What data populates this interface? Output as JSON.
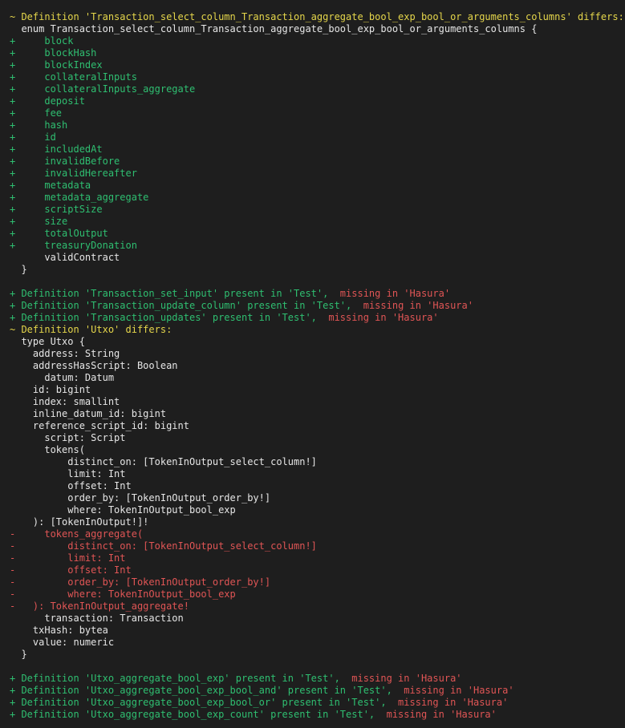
{
  "colors": {
    "background": "#1e1e1e",
    "normal": "#e6e6e6",
    "yellow": "#e5d64b",
    "green": "#2fbf71",
    "red": "#e05555"
  },
  "lines": [
    {
      "segments": [
        {
          "text": "~ Definition 'Transaction_select_column_Transaction_aggregate_bool_exp_bool_or_arguments_columns' differs:",
          "color": "yellow"
        }
      ]
    },
    {
      "segments": [
        {
          "text": "  enum Transaction_select_column_Transaction_aggregate_bool_exp_bool_or_arguments_columns {",
          "color": "normal"
        }
      ]
    },
    {
      "segments": [
        {
          "text": "+     block",
          "color": "green"
        }
      ]
    },
    {
      "segments": [
        {
          "text": "+     blockHash",
          "color": "green"
        }
      ]
    },
    {
      "segments": [
        {
          "text": "+     blockIndex",
          "color": "green"
        }
      ]
    },
    {
      "segments": [
        {
          "text": "+     collateralInputs",
          "color": "green"
        }
      ]
    },
    {
      "segments": [
        {
          "text": "+     collateralInputs_aggregate",
          "color": "green"
        }
      ]
    },
    {
      "segments": [
        {
          "text": "+     deposit",
          "color": "green"
        }
      ]
    },
    {
      "segments": [
        {
          "text": "+     fee",
          "color": "green"
        }
      ]
    },
    {
      "segments": [
        {
          "text": "+     hash",
          "color": "green"
        }
      ]
    },
    {
      "segments": [
        {
          "text": "+     id",
          "color": "green"
        }
      ]
    },
    {
      "segments": [
        {
          "text": "+     includedAt",
          "color": "green"
        }
      ]
    },
    {
      "segments": [
        {
          "text": "+     invalidBefore",
          "color": "green"
        }
      ]
    },
    {
      "segments": [
        {
          "text": "+     invalidHereafter",
          "color": "green"
        }
      ]
    },
    {
      "segments": [
        {
          "text": "+     metadata",
          "color": "green"
        }
      ]
    },
    {
      "segments": [
        {
          "text": "+     metadata_aggregate",
          "color": "green"
        }
      ]
    },
    {
      "segments": [
        {
          "text": "+     scriptSize",
          "color": "green"
        }
      ]
    },
    {
      "segments": [
        {
          "text": "+     size",
          "color": "green"
        }
      ]
    },
    {
      "segments": [
        {
          "text": "+     totalOutput",
          "color": "green"
        }
      ]
    },
    {
      "segments": [
        {
          "text": "+     treasuryDonation",
          "color": "green"
        }
      ]
    },
    {
      "segments": [
        {
          "text": "      validContract",
          "color": "normal"
        }
      ]
    },
    {
      "segments": [
        {
          "text": "  }",
          "color": "normal"
        }
      ]
    },
    {
      "segments": [
        {
          "text": "",
          "color": "normal"
        }
      ]
    },
    {
      "segments": [
        {
          "text": "+ Definition 'Transaction_set_input' present in 'Test',",
          "color": "green"
        },
        {
          "text": "  missing in 'Hasura'",
          "color": "red"
        }
      ]
    },
    {
      "segments": [
        {
          "text": "+ Definition 'Transaction_update_column' present in 'Test',",
          "color": "green"
        },
        {
          "text": "  missing in 'Hasura'",
          "color": "red"
        }
      ]
    },
    {
      "segments": [
        {
          "text": "+ Definition 'Transaction_updates' present in 'Test',",
          "color": "green"
        },
        {
          "text": "  missing in 'Hasura'",
          "color": "red"
        }
      ]
    },
    {
      "segments": [
        {
          "text": "~ Definition 'Utxo' differs:",
          "color": "yellow"
        }
      ]
    },
    {
      "segments": [
        {
          "text": "  type Utxo {",
          "color": "normal"
        }
      ]
    },
    {
      "segments": [
        {
          "text": "    address: String",
          "color": "normal"
        }
      ]
    },
    {
      "segments": [
        {
          "text": "    addressHasScript: Boolean",
          "color": "normal"
        }
      ]
    },
    {
      "segments": [
        {
          "text": "      datum: Datum",
          "color": "normal"
        }
      ]
    },
    {
      "segments": [
        {
          "text": "    id: bigint",
          "color": "normal"
        }
      ]
    },
    {
      "segments": [
        {
          "text": "    index: smallint",
          "color": "normal"
        }
      ]
    },
    {
      "segments": [
        {
          "text": "    inline_datum_id: bigint",
          "color": "normal"
        }
      ]
    },
    {
      "segments": [
        {
          "text": "    reference_script_id: bigint",
          "color": "normal"
        }
      ]
    },
    {
      "segments": [
        {
          "text": "      script: Script",
          "color": "normal"
        }
      ]
    },
    {
      "segments": [
        {
          "text": "      tokens(",
          "color": "normal"
        }
      ]
    },
    {
      "segments": [
        {
          "text": "          distinct_on: [TokenInOutput_select_column!]",
          "color": "normal"
        }
      ]
    },
    {
      "segments": [
        {
          "text": "          limit: Int",
          "color": "normal"
        }
      ]
    },
    {
      "segments": [
        {
          "text": "          offset: Int",
          "color": "normal"
        }
      ]
    },
    {
      "segments": [
        {
          "text": "          order_by: [TokenInOutput_order_by!]",
          "color": "normal"
        }
      ]
    },
    {
      "segments": [
        {
          "text": "          where: TokenInOutput_bool_exp",
          "color": "normal"
        }
      ]
    },
    {
      "segments": [
        {
          "text": "    ): [TokenInOutput!]!",
          "color": "normal"
        }
      ]
    },
    {
      "segments": [
        {
          "text": "-     tokens_aggregate(",
          "color": "red"
        }
      ]
    },
    {
      "segments": [
        {
          "text": "-         distinct_on: [TokenInOutput_select_column!]",
          "color": "red"
        }
      ]
    },
    {
      "segments": [
        {
          "text": "-         limit: Int",
          "color": "red"
        }
      ]
    },
    {
      "segments": [
        {
          "text": "-         offset: Int",
          "color": "red"
        }
      ]
    },
    {
      "segments": [
        {
          "text": "-         order_by: [TokenInOutput_order_by!]",
          "color": "red"
        }
      ]
    },
    {
      "segments": [
        {
          "text": "-         where: TokenInOutput_bool_exp",
          "color": "red"
        }
      ]
    },
    {
      "segments": [
        {
          "text": "-   ): TokenInOutput_aggregate!",
          "color": "red"
        }
      ]
    },
    {
      "segments": [
        {
          "text": "      transaction: Transaction",
          "color": "normal"
        }
      ]
    },
    {
      "segments": [
        {
          "text": "    txHash: bytea",
          "color": "normal"
        }
      ]
    },
    {
      "segments": [
        {
          "text": "    value: numeric",
          "color": "normal"
        }
      ]
    },
    {
      "segments": [
        {
          "text": "  }",
          "color": "normal"
        }
      ]
    },
    {
      "segments": [
        {
          "text": "",
          "color": "normal"
        }
      ]
    },
    {
      "segments": [
        {
          "text": "+ Definition 'Utxo_aggregate_bool_exp' present in 'Test',",
          "color": "green"
        },
        {
          "text": "  missing in 'Hasura'",
          "color": "red"
        }
      ]
    },
    {
      "segments": [
        {
          "text": "+ Definition 'Utxo_aggregate_bool_exp_bool_and' present in 'Test',",
          "color": "green"
        },
        {
          "text": "  missing in 'Hasura'",
          "color": "red"
        }
      ]
    },
    {
      "segments": [
        {
          "text": "+ Definition 'Utxo_aggregate_bool_exp_bool_or' present in 'Test',",
          "color": "green"
        },
        {
          "text": "  missing in 'Hasura'",
          "color": "red"
        }
      ]
    },
    {
      "segments": [
        {
          "text": "+ Definition 'Utxo_aggregate_bool_exp_count' present in 'Test',",
          "color": "green"
        },
        {
          "text": "  missing in 'Hasura'",
          "color": "red"
        }
      ]
    }
  ]
}
